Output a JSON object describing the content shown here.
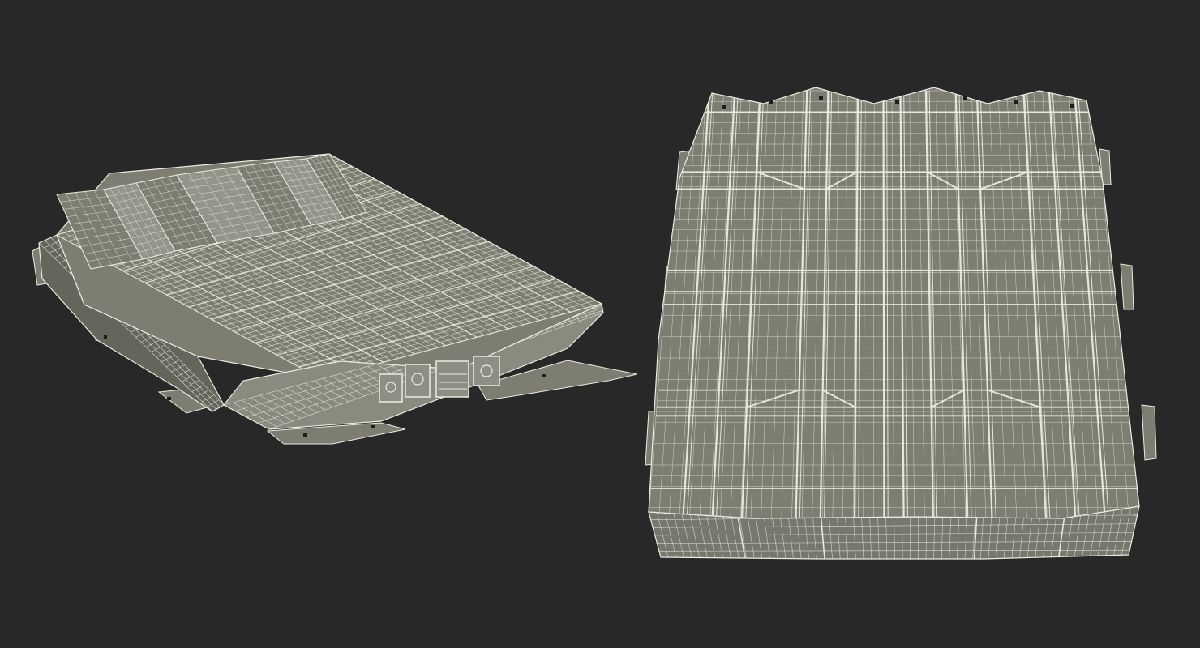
{
  "scene": {
    "background": "#282828",
    "wire_color": "#ecebe0",
    "surface_color": "#7d7d71",
    "surface_dark": "#65655b",
    "surface_light": "#94948a",
    "views": [
      {
        "name": "battery-pack-perspective-view"
      },
      {
        "name": "battery-pack-top-view"
      }
    ]
  }
}
